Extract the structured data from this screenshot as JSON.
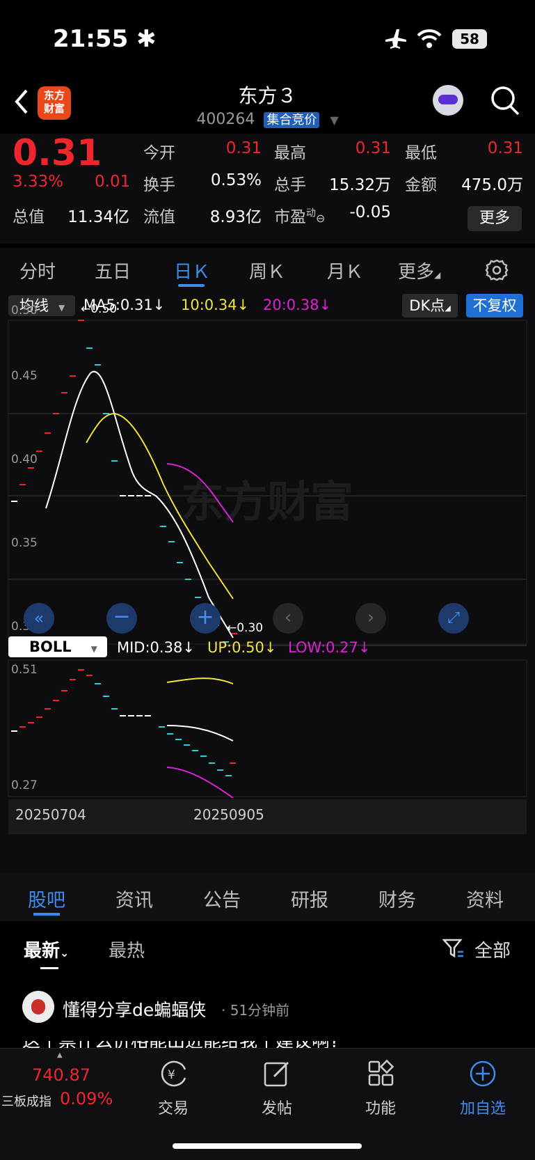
{
  "status": {
    "time": "21:55",
    "battery": "58"
  },
  "header": {
    "title": "东方３",
    "code": "400264",
    "auction_badge": "集合竞价",
    "logo_line1": "东方",
    "logo_line2": "财富"
  },
  "quote": {
    "price": "0.31",
    "pct": "3.33%",
    "change": "0.01",
    "open_label": "今开",
    "open": "0.31",
    "high_label": "最高",
    "high": "0.31",
    "low_label": "最低",
    "low": "0.31",
    "turnover_label": "换手",
    "turnover": "0.53%",
    "volume_label": "总手",
    "volume": "15.32万",
    "amount_label": "金额",
    "amount": "475.0万",
    "mktcap_label": "总值",
    "mktcap": "11.34亿",
    "float_label": "流值",
    "float": "8.93亿",
    "pe_label": "市盈",
    "pe_sup": "动",
    "pe": "-0.05",
    "more": "更多"
  },
  "period_tabs": [
    "分时",
    "五日",
    "日Ｋ",
    "周Ｋ",
    "月Ｋ",
    "更多"
  ],
  "chart": {
    "indicator": "均线",
    "ma5": "MA5:0.31↓",
    "ma10": "10:0.34↓",
    "ma20": "20:0.38↓",
    "dk": "DK点",
    "adjust": "不复权",
    "y_ticks": [
      "0.50",
      "0.45",
      "0.40",
      "0.35",
      "0.30"
    ],
    "high_tag": "←0.50",
    "low_tag": "←0.30",
    "boll_label": "BOLL",
    "boll_mid": "MID:0.38↓",
    "boll_up": "UP:0.50↓",
    "boll_low": "LOW:0.27↓",
    "boll_top": "0.51",
    "boll_bottom": "0.27",
    "date_start": "20250704",
    "date_end": "20250905",
    "watermark": "东方财富",
    "colors": {
      "up": "#f0262e",
      "down": "#2ad0e0",
      "ma5": "#ffffff",
      "ma10": "#f2e33a",
      "ma20": "#e020d8"
    }
  },
  "content_tabs": [
    "股吧",
    "资讯",
    "公告",
    "研报",
    "财务",
    "资料"
  ],
  "sort": {
    "latest": "最新",
    "hot": "最热",
    "filter": "全部"
  },
  "post": {
    "author": "懂得分享de蝙蝠侠",
    "time": "· 51分钟前",
    "text": "这个票什么价格能出进能给我个建议啊?"
  },
  "bottom_nav": {
    "index_value": "740.87",
    "index_name": "三板成指",
    "index_pct": "0.09%",
    "trade": "交易",
    "post": "发帖",
    "func": "功能",
    "add": "加自选"
  }
}
